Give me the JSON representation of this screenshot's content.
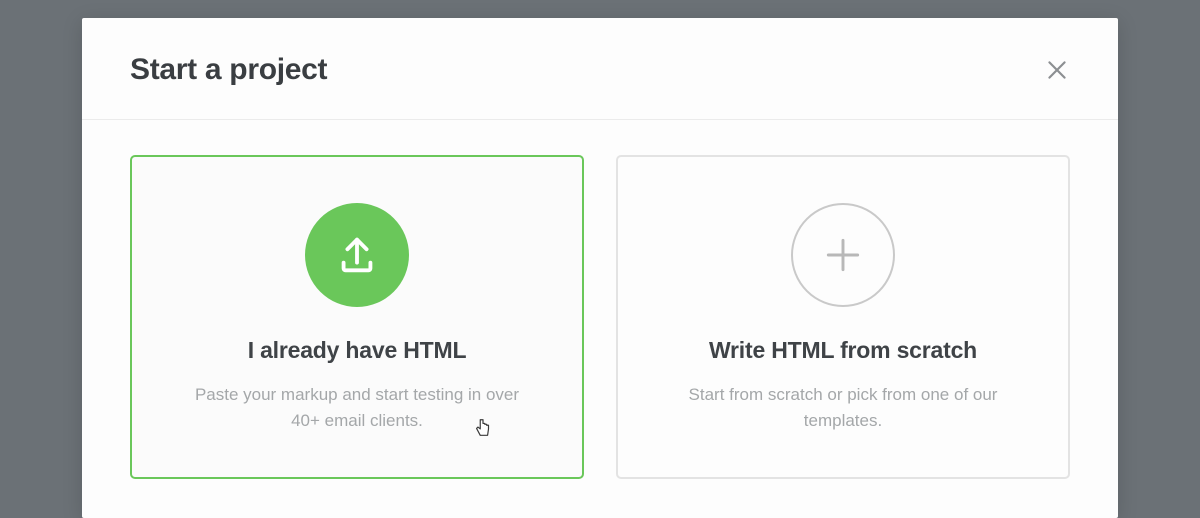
{
  "modal": {
    "title": "Start a project"
  },
  "options": [
    {
      "title": "I already have HTML",
      "description": "Paste your markup and start testing in over 40+ email clients."
    },
    {
      "title": "Write HTML from scratch",
      "description": "Start from scratch or pick from one of our templates."
    }
  ]
}
